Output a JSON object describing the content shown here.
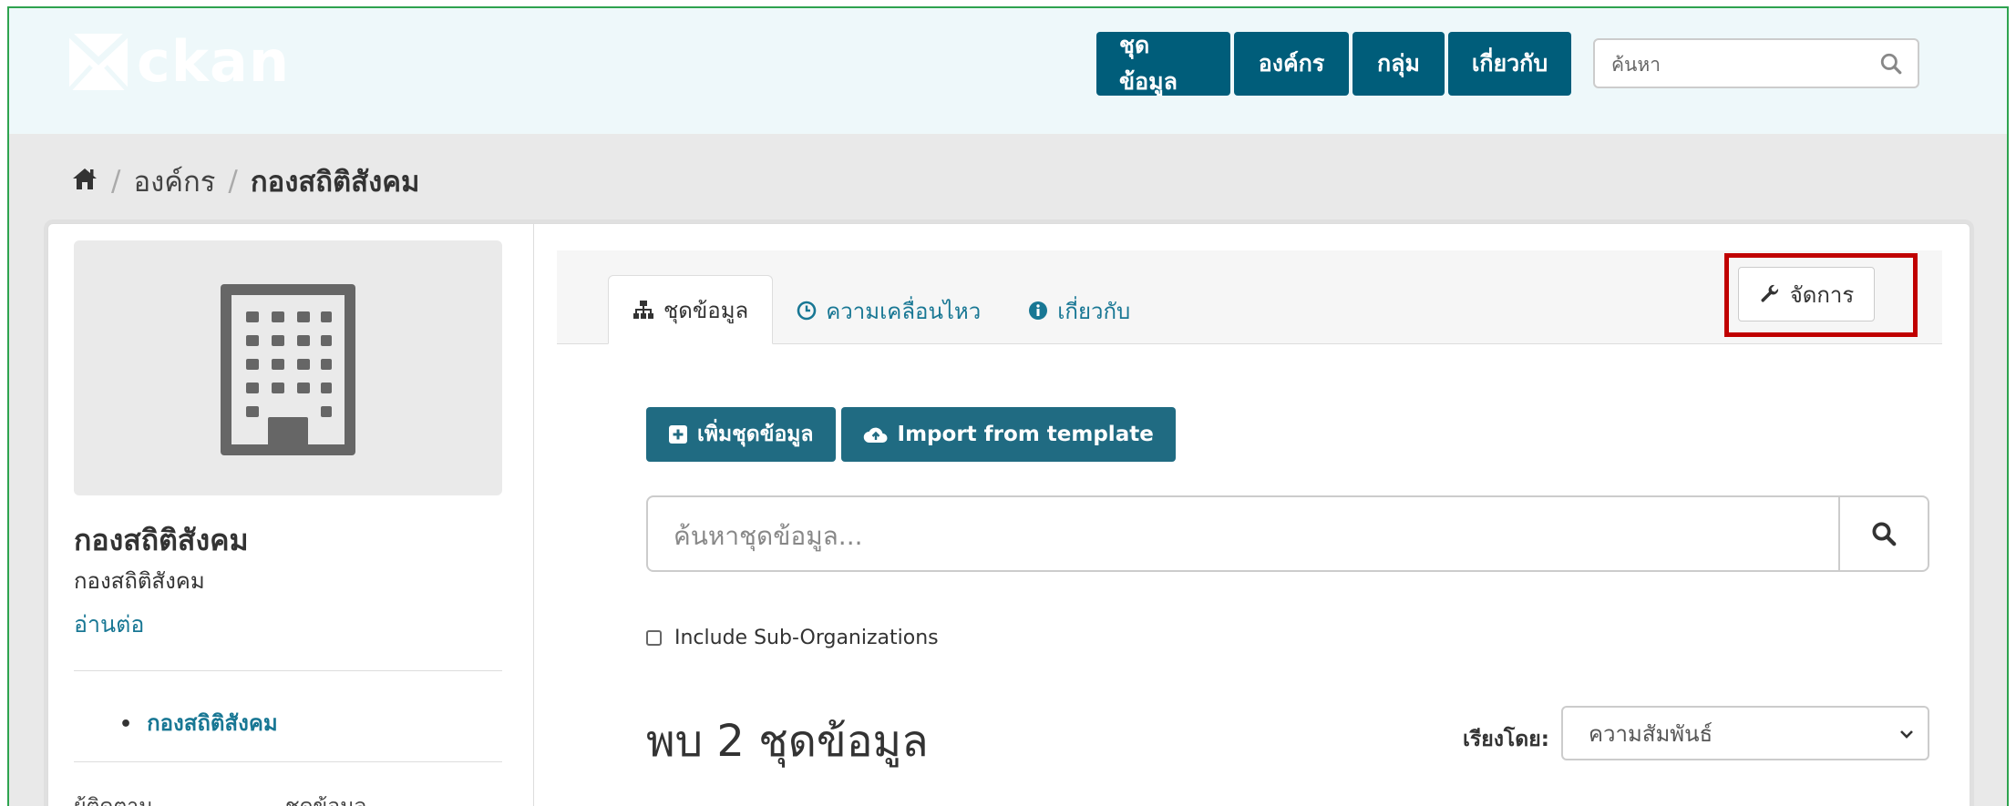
{
  "header": {
    "logo_text": "ckan",
    "nav": [
      {
        "label": "ชุดข้อมูล"
      },
      {
        "label": "องค์กร"
      },
      {
        "label": "กลุ่ม"
      },
      {
        "label": "เกี่ยวกับ"
      }
    ],
    "search_placeholder": "ค้นหา"
  },
  "breadcrumb": {
    "home_icon": "home-icon",
    "items": [
      "องค์กร",
      "กองสถิติสังคม"
    ]
  },
  "sidebar": {
    "org_image_icon": "building-icon",
    "title": "กองสถิติสังคม",
    "description": "กองสถิติสังคม",
    "read_more": "อ่านต่อ",
    "tree_items": [
      "กองสถิติสังคม"
    ],
    "stats": {
      "followers_label": "ผู้ติดตาม",
      "datasets_label": "ชุดข้อมูล"
    }
  },
  "tabs": [
    {
      "label": "ชุดข้อมูล",
      "icon": "sitemap-icon",
      "active": true
    },
    {
      "label": "ความเคลื่อนไหว",
      "icon": "clock-icon",
      "active": false
    },
    {
      "label": "เกี่ยวกับ",
      "icon": "info-icon",
      "active": false
    }
  ],
  "manage_button": {
    "label": "จัดการ",
    "icon": "wrench-icon"
  },
  "actions": {
    "add_dataset": "เพิ่มชุดข้อมูล",
    "import_template": "Import from template"
  },
  "dataset_search": {
    "placeholder": "ค้นหาชุดข้อมูล..."
  },
  "include_sub_orgs": {
    "label": "Include Sub-Organizations",
    "checked": false
  },
  "results": {
    "count_text": "พบ 2 ชุดข้อมูล"
  },
  "sort": {
    "label": "เรียงโดย:",
    "selected": "ความสัมพันธ์"
  },
  "colors": {
    "primary": "#005d7a",
    "accent": "#206b82",
    "highlight": "#c00000"
  }
}
